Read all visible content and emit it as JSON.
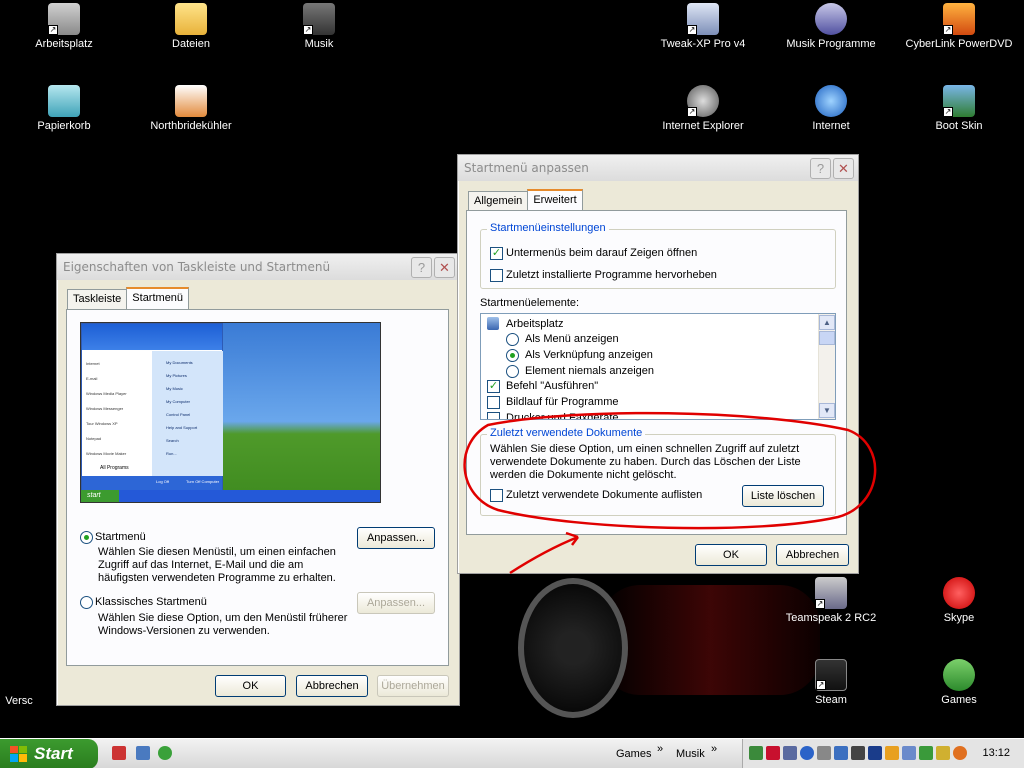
{
  "desktop": {
    "icons_left": [
      {
        "label": "Arbeitsplatz",
        "icon": "counter-strike-icon"
      },
      {
        "label": "Dateien",
        "icon": "folder-icon"
      },
      {
        "label": "Musik",
        "icon": "music-folder-icon"
      },
      {
        "label": "Papierkorb",
        "icon": "recycle-bin-icon"
      },
      {
        "label": "Northbridekühler",
        "icon": "document-icon"
      }
    ],
    "icons_right": [
      {
        "label": "Tweak-XP Pro v4",
        "icon": "tweak-icon"
      },
      {
        "label": "Musik Programme",
        "icon": "music-note-icon"
      },
      {
        "label": "CyberLink PowerDVD",
        "icon": "dvd-icon"
      },
      {
        "label": "Internet Explorer",
        "icon": "ie-icon"
      },
      {
        "label": "Internet",
        "icon": "globe-icon"
      },
      {
        "label": "Boot Skin",
        "icon": "boot-skin-icon"
      },
      {
        "label": "Teamspeak 2 RC2",
        "icon": "teamspeak-icon"
      },
      {
        "label": "Skype",
        "icon": "skype-icon"
      },
      {
        "label": "Steam",
        "icon": "steam-icon"
      },
      {
        "label": "Games",
        "icon": "games-icon"
      }
    ],
    "partial_label": "Versc"
  },
  "taskbar_dialog": {
    "title": "Eigenschaften von Taskleiste und Startmenü",
    "tabs": [
      "Taskleiste",
      "Startmenü"
    ],
    "active_tab": "Startmenü",
    "preview": {
      "menu_left_items": [
        "Internet",
        "E-mail",
        "Windows Media Player",
        "Windows Messenger",
        "Tour Windows XP",
        "Notepad",
        "Windows Movie Maker"
      ],
      "menu_right_items": [
        "My Documents",
        "My Pictures",
        "My Music",
        "My Computer",
        "Control Panel",
        "Help and Support",
        "Search",
        "Run..."
      ],
      "all_programs": "All Programs",
      "logoff": "Log Off",
      "turnoff": "Turn Off Computer",
      "start": "start"
    },
    "option_startmenu": {
      "label": "Startmenü",
      "selected": true,
      "description": "Wählen Sie diesen Menüstil, um einen einfachen Zugriff auf das Internet, E-Mail und die am häufigsten verwendeten Programme zu erhalten.",
      "button": "Anpassen..."
    },
    "option_classic": {
      "label": "Klassisches Startmenü",
      "selected": false,
      "description": "Wählen Sie diese Option, um den Menüstil früherer Windows-Versionen zu verwenden.",
      "button": "Anpassen..."
    },
    "buttons": {
      "ok": "OK",
      "cancel": "Abbrechen",
      "apply": "Übernehmen"
    }
  },
  "startmenu_dialog": {
    "title": "Startmenü anpassen",
    "tabs": [
      "Allgemein",
      "Erweitert"
    ],
    "active_tab": "Erweitert",
    "settings_group": {
      "legend": "Startmenüeinstellungen",
      "items": [
        {
          "label": "Untermenüs beim darauf Zeigen öffnen",
          "checked": true
        },
        {
          "label": "Zuletzt installierte Programme hervorheben",
          "checked": false
        }
      ]
    },
    "elements_label": "Startmenüelemente:",
    "elements": [
      {
        "type": "header",
        "label": "Arbeitsplatz"
      },
      {
        "type": "radio",
        "label": "Als Menü anzeigen",
        "checked": false
      },
      {
        "type": "radio",
        "label": "Als Verknüpfung anzeigen",
        "checked": true
      },
      {
        "type": "radio",
        "label": "Element niemals anzeigen",
        "checked": false
      },
      {
        "type": "check",
        "label": "Befehl \"Ausführen\"",
        "checked": true
      },
      {
        "type": "check",
        "label": "Bildlauf für Programme",
        "checked": false
      },
      {
        "type": "check",
        "label": "Drucker und Faxgeräte",
        "checked": false
      }
    ],
    "recent_group": {
      "legend": "Zuletzt verwendete Dokumente",
      "description": "Wählen Sie diese Option, um einen schnellen Zugriff auf zuletzt verwendete Dokumente zu haben. Durch das Löschen der Liste werden die Dokumente nicht gelöscht.",
      "checkbox": "Zuletzt verwendete Dokumente auflisten",
      "checked": false,
      "clear_button": "Liste löschen"
    },
    "buttons": {
      "ok": "OK",
      "cancel": "Abbrechen"
    }
  },
  "taskbar": {
    "start_label": "Start",
    "toolbars": [
      "Games",
      "Musik"
    ],
    "clock": "13:12"
  },
  "colors": {
    "annotation": "#e00000",
    "start_green": "#3c9b2f",
    "legend_blue": "#0046d5"
  }
}
